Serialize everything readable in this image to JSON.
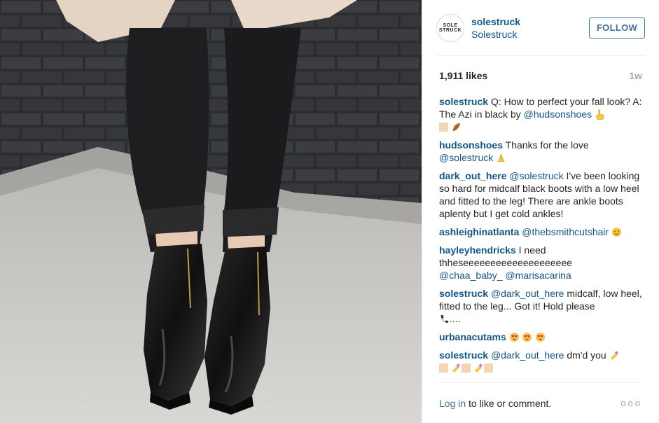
{
  "post": {
    "author": {
      "username": "solestruck",
      "location": "Solestruck",
      "avatar_text_top": "SOLE",
      "avatar_text_bottom": "STRUCK"
    },
    "follow_label": "FOLLOW",
    "likes": "1,911 likes",
    "time": "1w"
  },
  "comments": [
    {
      "author": "solestruck",
      "text": "Q: How to perfect your fall look? A: The Azi in black by",
      "mention": "@hudsonshoes",
      "emoji": [
        "point-up-hand-icon",
        "skin-tone-swatch-icon",
        "fallen-leaf-icon"
      ]
    },
    {
      "author": "hudsonshoes",
      "text": "Thanks for the love",
      "mention": "@solestruck",
      "emoji": [
        "praying-hands-icon"
      ]
    },
    {
      "author": "dark_out_here",
      "mention": "@solestruck",
      "text": "I've been looking so hard for midcalf black boots with a low heel and fitted to the leg! There are ankle boots aplenty but I get cold ankles!"
    },
    {
      "author": "ashleighinatlanta",
      "mention": "@thebsmithcutshair",
      "emoji": [
        "winking-face-icon"
      ]
    },
    {
      "author": "hayleyhendricks",
      "text": "I need thheseeeeeeeeeeeeeeeeeeee",
      "mention": "@chaa_baby_",
      "mention2": "@marisacarina"
    },
    {
      "author": "solestruck",
      "mention": "@dark_out_here",
      "text": "midcalf, low heel, fitted to the leg... Got it! Hold please",
      "trailing": "....",
      "emoji": [
        "telephone-icon"
      ]
    },
    {
      "author": "urbanacutams",
      "emoji": [
        "heart-eyes-icon",
        "heart-eyes-icon",
        "heart-eyes-icon"
      ]
    },
    {
      "author": "solestruck",
      "mention": "@dark_out_here",
      "text": "dm'd you",
      "emoji": [
        "nail-polish-icon",
        "skin-tone-swatch-icon",
        "nail-polish-icon",
        "skin-tone-swatch-icon",
        "nail-polish-icon",
        "skin-tone-swatch-icon"
      ]
    }
  ],
  "footer": {
    "login_link": "Log in",
    "login_suffix": " to like or comment.",
    "more_label": "ooo"
  },
  "colors": {
    "link": "#125688",
    "button": "#3f729b",
    "muted": "#a5a7aa",
    "border": "#efefef"
  }
}
